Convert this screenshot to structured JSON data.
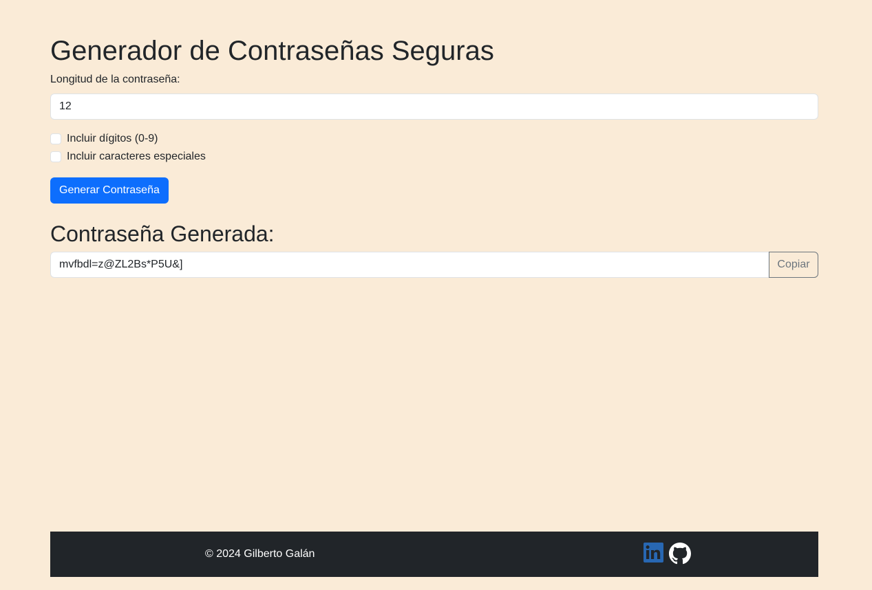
{
  "page": {
    "title": "Generador de Contraseñas Seguras",
    "background_color": "#faebd7"
  },
  "form": {
    "length_label": "Longitud de la contraseña:",
    "length_value": "12",
    "options": [
      {
        "label": "Incluir dígitos (0-9)",
        "checked": false
      },
      {
        "label": "Incluir caracteres especiales",
        "checked": false
      }
    ],
    "generate_label": "Generar Contraseña",
    "generate_color": "#0d6efd"
  },
  "result": {
    "title": "Contraseña Generada:",
    "password": "mvfbdl=z@ZL2Bs*P5U&]",
    "copy_label": "Copiar"
  },
  "footer": {
    "copyright": "© 2024 Gilberto Galán",
    "background_color": "#212529",
    "social_links": [
      {
        "icon": "linkedin-icon",
        "color": "#2867b2"
      },
      {
        "icon": "github-icon",
        "color": "#ffffff"
      }
    ]
  }
}
